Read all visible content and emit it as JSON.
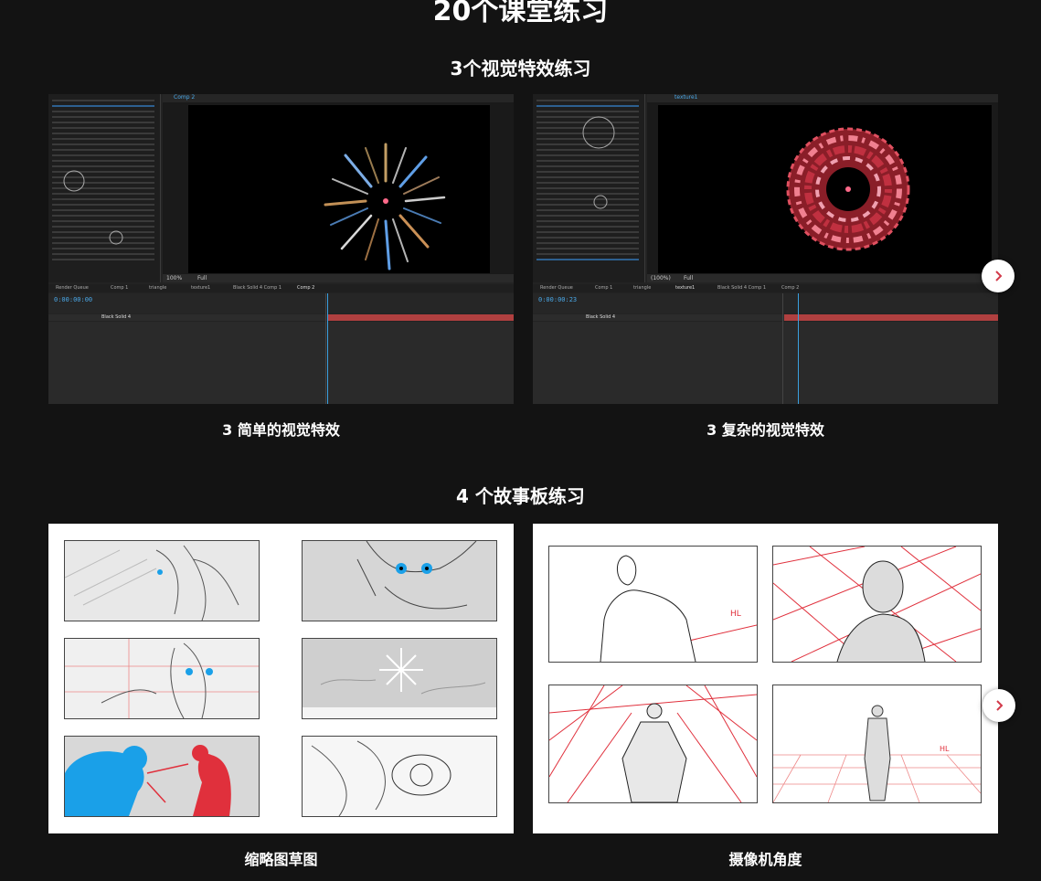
{
  "page": {
    "title": "20个课堂练习"
  },
  "sections": [
    {
      "title": "3个视觉特效练习",
      "items": [
        {
          "caption": "3 简单的视觉特效",
          "screenshot_text": {
            "comp_tab": "Comp 2",
            "timecode": "0:00:00:00",
            "layer_name": "Black Solid 4",
            "zoom": "100%",
            "resolution": "Full",
            "panel_tabs": [
              "Render Queue",
              "Comp 1",
              "triangle",
              "texture1",
              "Black Solid 4 Comp 1",
              "Comp 2"
            ]
          }
        },
        {
          "caption": "3 复杂的视觉特效",
          "screenshot_text": {
            "comp_tab": "texture1",
            "timecode": "0:00:00:23",
            "layer_name": "Black Solid 4",
            "zoom": "(100%)",
            "resolution": "Full",
            "panel_tabs": [
              "Render Queue",
              "Comp 1",
              "triangle",
              "texture1",
              "Black Solid 4 Comp 1",
              "Comp 2"
            ]
          }
        }
      ],
      "next_icon": "chevron-right-icon"
    },
    {
      "title": "4 个故事板练习",
      "items": [
        {
          "caption": "缩略图草图"
        },
        {
          "caption": "摄像机角度",
          "annotation": "HL"
        }
      ],
      "next_icon": "chevron-right-icon"
    }
  ],
  "colors": {
    "background": "#131313",
    "accent": "#d23a4a",
    "ae_blue": "#4aa8e8",
    "storyboard_red": "#e0303c",
    "storyboard_blue": "#1aa0e8"
  }
}
